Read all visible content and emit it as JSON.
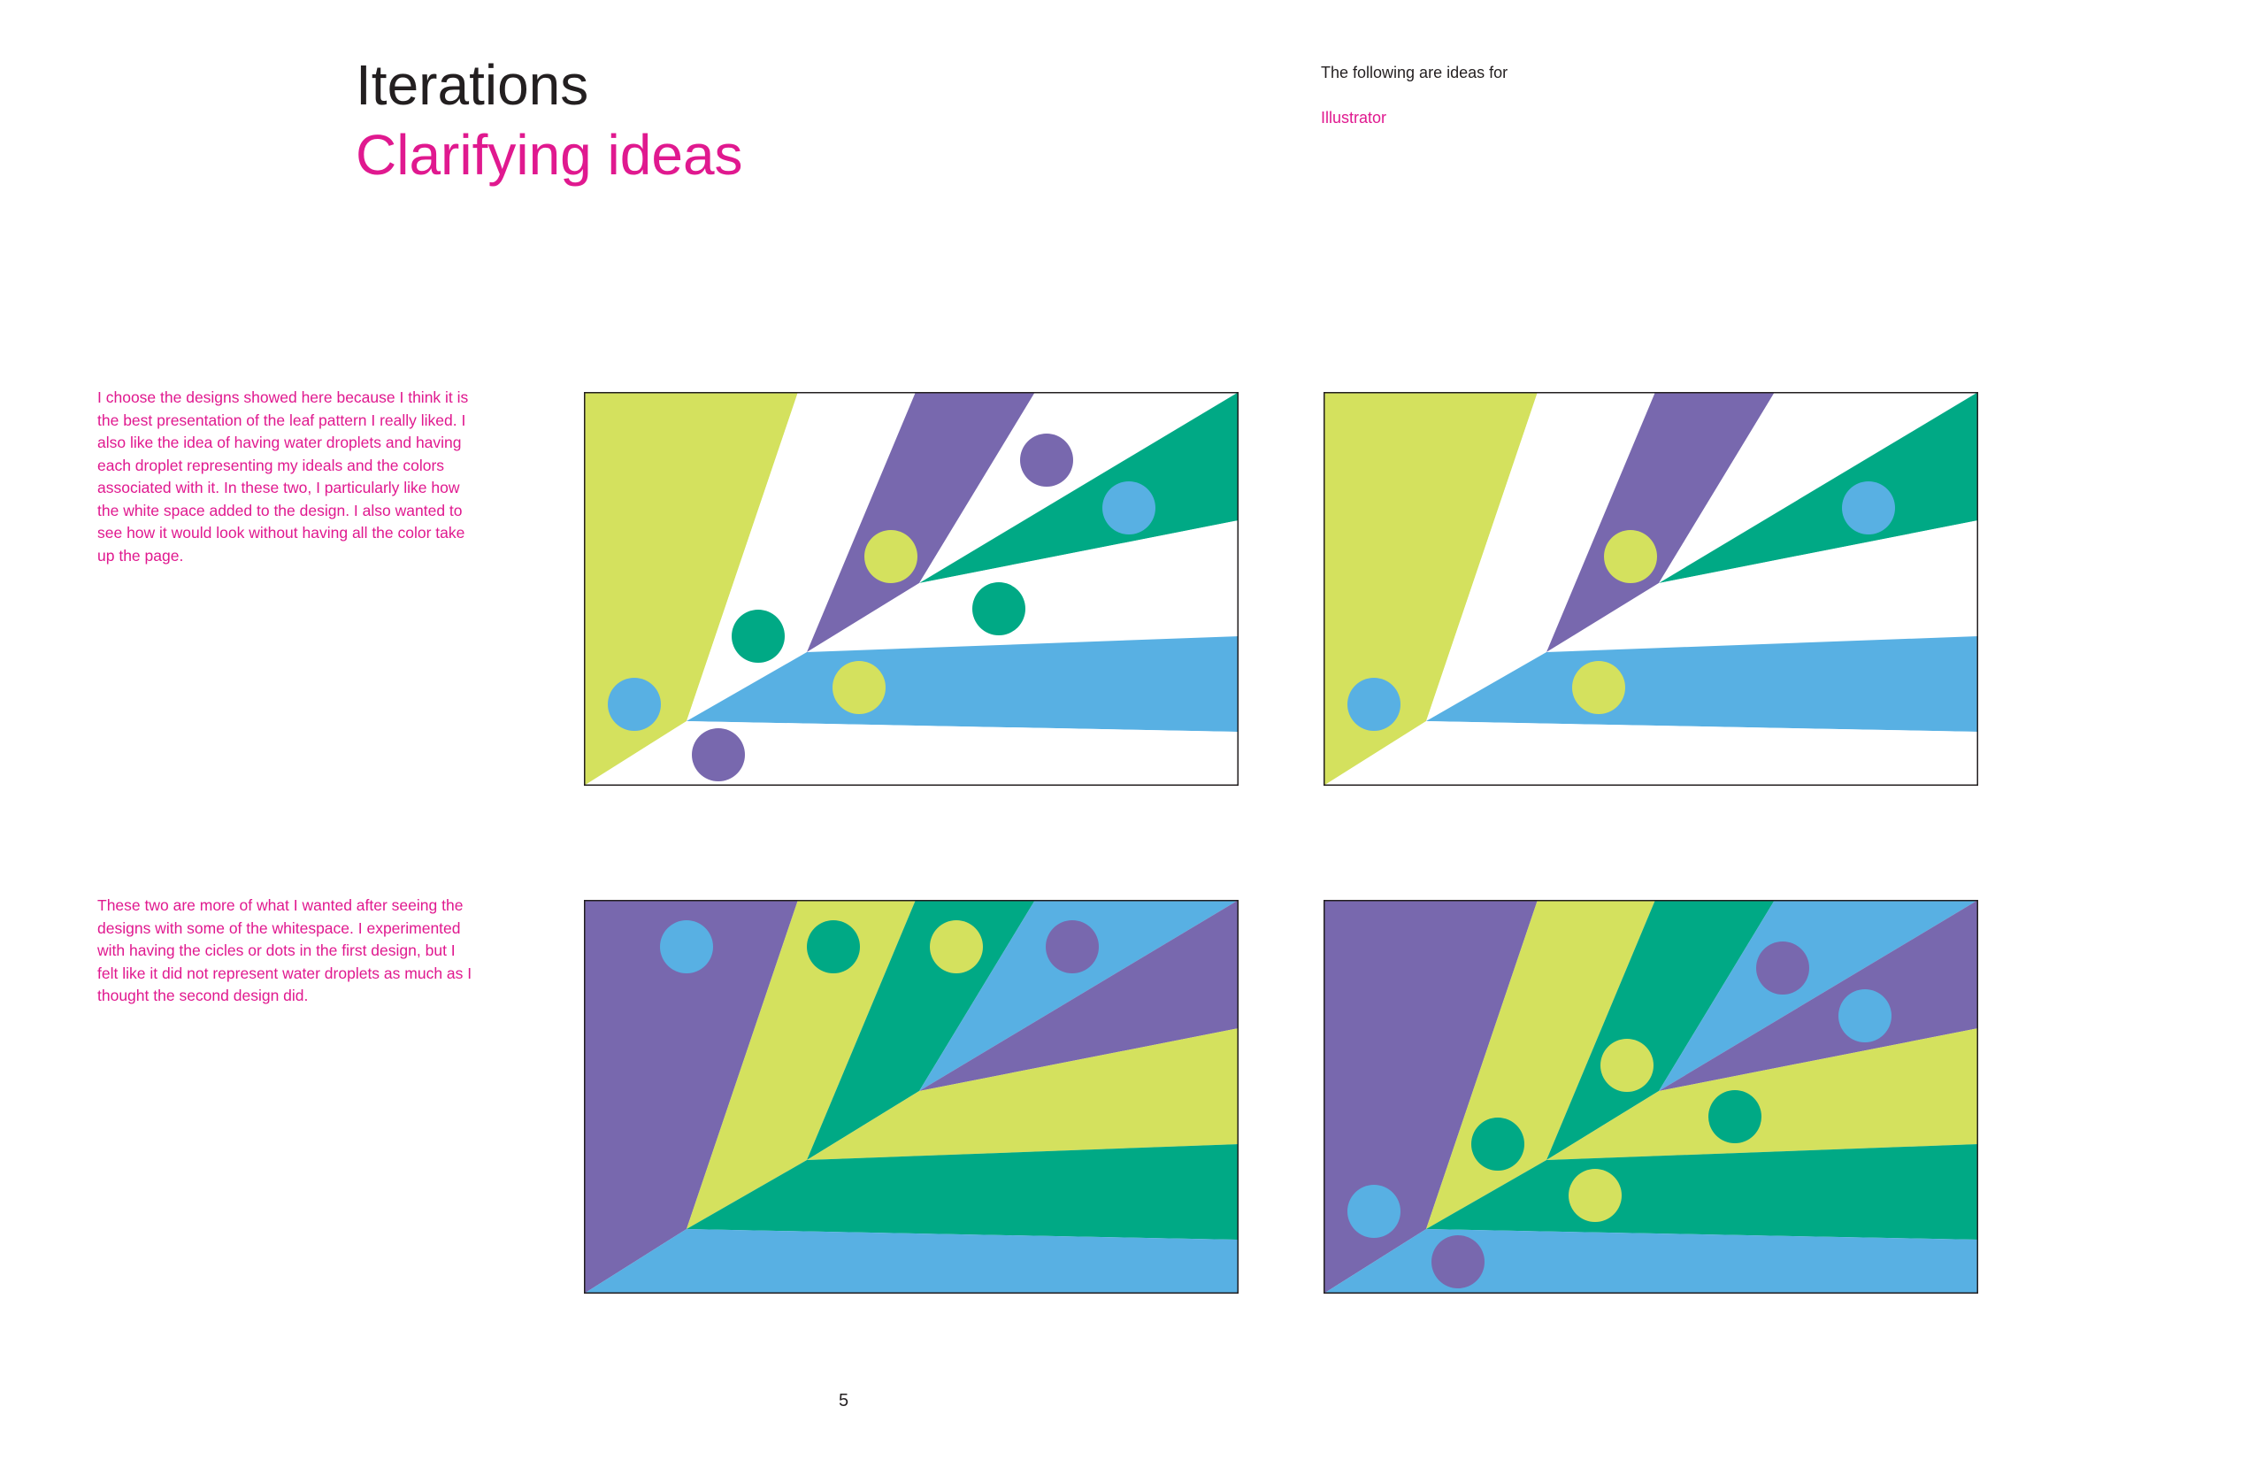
{
  "page": {
    "title": "Iterations",
    "subtitle": "Clarifying ideas",
    "side_note": "The following are ideas for",
    "side_link": "Illustrator",
    "paragraph_1": "I choose the designs showed here because I think it is the best presentation of the leaf pattern I really liked. I also like the idea of having water droplets and having each droplet representing my ideals and the colors associated with it. In these two, I particularly like how the white space added to the design. I also wanted to see how it would look without having all the color take up the page.",
    "paragraph_2": "These two are more of what I wanted after seeing the designs with some of the whitespace. I experimented with having the cicles or dots in the first design, but I felt like it did not represent water droplets as much as I thought the second design did.",
    "page_number": "5"
  },
  "colors": {
    "yellow_green": "#d4e15e",
    "purple": "#7868ae",
    "teal": "#00a985",
    "blue": "#58b0e3",
    "white": "#ffffff",
    "text_magenta": "#e0198f",
    "text_dark": "#231f20"
  },
  "artboards": [
    {
      "name": "design-1-whitespace-with-circles",
      "bands": [
        "yellow_green",
        "white",
        "purple",
        "white",
        "teal",
        "white",
        "blue",
        "white"
      ],
      "circles": [
        "blue",
        "purple",
        "teal",
        "yellow_green",
        "yellow_green",
        "teal",
        "purple",
        "blue"
      ]
    },
    {
      "name": "design-2-whitespace",
      "bands": [
        "yellow_green",
        "white",
        "purple",
        "white",
        "teal",
        "white",
        "blue",
        "white"
      ],
      "circles": [
        "blue",
        "yellow_green",
        "yellow_green",
        "blue"
      ]
    },
    {
      "name": "design-3-full-color-top-circles",
      "bands": [
        "purple",
        "yellow_green",
        "teal",
        "blue",
        "purple",
        "yellow_green",
        "teal",
        "blue"
      ],
      "circles": [
        "blue",
        "teal",
        "yellow_green",
        "purple"
      ]
    },
    {
      "name": "design-4-full-color-scattered-circles",
      "bands": [
        "purple",
        "yellow_green",
        "teal",
        "blue",
        "purple",
        "yellow_green",
        "teal",
        "blue"
      ],
      "circles": [
        "blue",
        "purple",
        "teal",
        "yellow_green",
        "yellow_green",
        "teal",
        "purple",
        "blue"
      ]
    }
  ]
}
